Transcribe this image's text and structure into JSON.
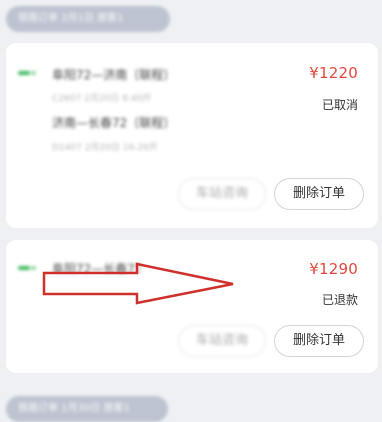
{
  "pills": {
    "top": "铁路订单 2月1日 旅客1",
    "bottom": "铁路订单 1月30日 旅客1"
  },
  "orders": [
    {
      "route1": "阜阳72—济南〔联程〕",
      "detail1": "C2607  2月20日 8:40开",
      "route2": "济南—长春72〔联程〕",
      "detail2": "D1407  2月20日 16:26开",
      "price": "¥1220",
      "status": "已取消",
      "ghost_button": "车站咨询",
      "delete_button": "删除订单"
    },
    {
      "route1": "阜阳72—长春72",
      "price": "¥1290",
      "status": "已退款",
      "ghost_button": "车站咨询",
      "delete_button": "删除订单"
    }
  ],
  "colors": {
    "price": "#e0483d",
    "arrow": "#d0302b",
    "train_icon": "#3db860"
  },
  "icons": {
    "train": "train-icon",
    "annotation": "red-arrow-annotation"
  }
}
